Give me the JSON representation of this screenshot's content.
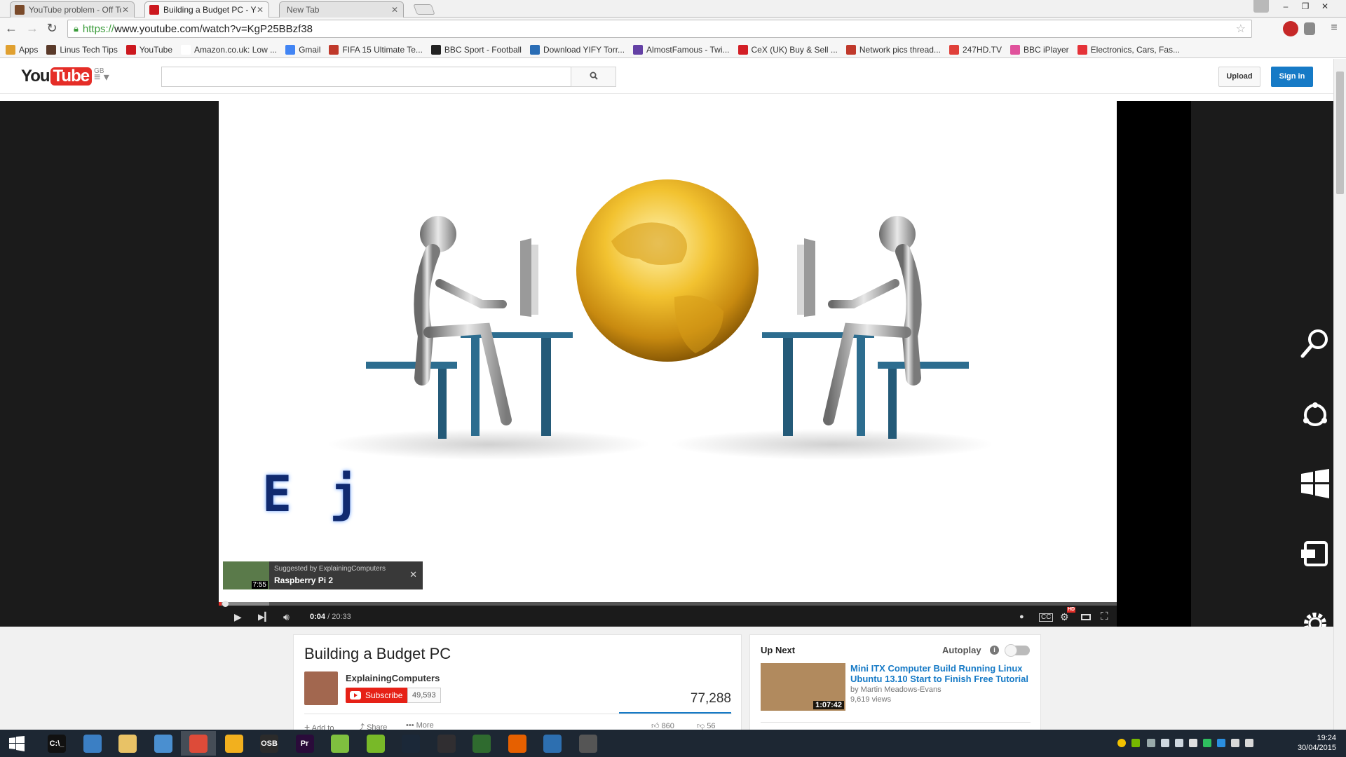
{
  "browser": {
    "tabs": [
      {
        "title": "YouTube problem - Off To",
        "active": false
      },
      {
        "title": "Building a Budget PC - Yo",
        "active": true
      },
      {
        "title": "New Tab",
        "active": false
      }
    ],
    "url_protocol": "https://",
    "url_rest": "www.youtube.com/watch?v=KgP25BBzf38",
    "bookmarks": [
      {
        "label": "Apps",
        "icon": "apps-grid-icon",
        "color": "#e0a030"
      },
      {
        "label": "Linus Tech Tips",
        "icon": "ltt-icon",
        "color": "#5a3a2a"
      },
      {
        "label": "YouTube",
        "icon": "youtube-icon",
        "color": "#cc181e"
      },
      {
        "label": "Amazon.co.uk: Low ...",
        "icon": "amazon-icon",
        "color": "#ffffff"
      },
      {
        "label": "Gmail",
        "icon": "google-icon",
        "color": "#4285f4"
      },
      {
        "label": "FIFA 15 Ultimate Te...",
        "icon": "fut-icon",
        "color": "#c0392b"
      },
      {
        "label": "BBC Sport - Football",
        "icon": "bbc-icon",
        "color": "#222222"
      },
      {
        "label": "Download YIFY Torr...",
        "icon": "yify-icon",
        "color": "#2a6db5"
      },
      {
        "label": "AlmostFamous - Twi...",
        "icon": "twitch-icon",
        "color": "#6441a5"
      },
      {
        "label": "CeX (UK) Buy & Sell ...",
        "icon": "cex-icon",
        "color": "#d31f26"
      },
      {
        "label": "Network pics thread...",
        "icon": "hexus-icon",
        "color": "#c0392b"
      },
      {
        "label": "247HD.TV",
        "icon": "247hd-icon",
        "color": "#e0403a"
      },
      {
        "label": "BBC iPlayer",
        "icon": "iplayer-icon",
        "color": "#e0529c"
      },
      {
        "label": "Electronics, Cars, Fas...",
        "icon": "ebay-icon",
        "color": "#e53238"
      }
    ]
  },
  "youtube": {
    "logo_you": "You",
    "logo_tube": "Tube",
    "logo_region": "GB",
    "upload_label": "Upload",
    "signin_label": "Sign in",
    "player": {
      "intro_letters": "E j",
      "suggestion_label": "Suggested by ExplainingComputers",
      "suggestion_title": "Raspberry Pi 2",
      "suggestion_duration": "7:55",
      "current_time": "0:04",
      "total_time": "/ 20:33",
      "progress_fraction": 0.0032,
      "hd_badge": "HD"
    },
    "video": {
      "title": "Building a Budget PC",
      "channel": "ExplainingComputers",
      "subscribe_label": "Subscribe",
      "subscriber_count": "49,593",
      "views": "77,288",
      "actions": [
        "Add to",
        "Share",
        "More"
      ],
      "likes": "860",
      "dislikes": "56"
    },
    "up_next": {
      "label": "Up Next",
      "autoplay_label": "Autoplay",
      "title": "Mini ITX Computer Build Running Linux Ubuntu 13.10 Start to Finish Free Tutorial",
      "by": "by Martin Meadows-Evans",
      "views": "9,619 views",
      "duration": "1:07:42"
    }
  },
  "taskbar": {
    "apps": [
      {
        "name": "cmd",
        "label": "C:\\_",
        "color": "#111111"
      },
      {
        "name": "computer",
        "label": "",
        "color": "#3b7fc4"
      },
      {
        "name": "explorer",
        "label": "",
        "color": "#e8c266"
      },
      {
        "name": "network",
        "label": "",
        "color": "#4a8fd0"
      },
      {
        "name": "chrome",
        "label": "",
        "color": "#dd4b39"
      },
      {
        "name": "audio",
        "label": "",
        "color": "#f2b01e"
      },
      {
        "name": "obs",
        "label": "OSB",
        "color": "#2b2b2b"
      },
      {
        "name": "premiere",
        "label": "Pr",
        "color": "#2a0b3a"
      },
      {
        "name": "notepad",
        "label": "",
        "color": "#7fbf3f"
      },
      {
        "name": "utorrent",
        "label": "",
        "color": "#78b928"
      },
      {
        "name": "steam",
        "label": "",
        "color": "#1b2838"
      },
      {
        "name": "obs-studio",
        "label": "",
        "color": "#302e31"
      },
      {
        "name": "game",
        "label": "",
        "color": "#2f6b2f"
      },
      {
        "name": "firefox",
        "label": "",
        "color": "#e66000"
      },
      {
        "name": "paint",
        "label": "",
        "color": "#2d6fb0"
      },
      {
        "name": "video",
        "label": "",
        "color": "#555555"
      }
    ],
    "time": "19:24",
    "date": "30/04/2015"
  }
}
